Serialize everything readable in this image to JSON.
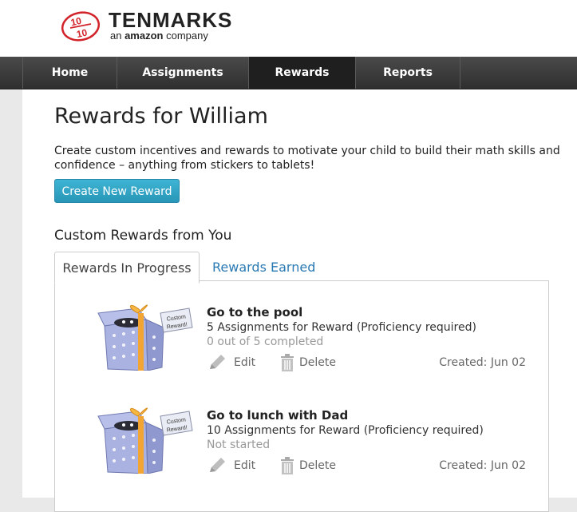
{
  "logo": {
    "brand": "TENMARKS",
    "tagline_prefix": "an ",
    "tagline_brand": "amazon",
    "tagline_suffix": " company",
    "mark_top": "10",
    "mark_bottom": "10"
  },
  "nav": {
    "items": [
      {
        "label": "Home",
        "active": false
      },
      {
        "label": "Assignments",
        "active": false
      },
      {
        "label": "Rewards",
        "active": true
      },
      {
        "label": "Reports",
        "active": false
      }
    ]
  },
  "page": {
    "title": "Rewards for William",
    "intro": "Create custom incentives and rewards to motivate your child to build their math skills and confidence – anything from stickers to tablets!",
    "create_button": "Create New Reward",
    "section_title": "Custom Rewards from You"
  },
  "tabs": [
    {
      "label": "Rewards In Progress",
      "active": true
    },
    {
      "label": "Rewards Earned",
      "active": false
    }
  ],
  "rewards": [
    {
      "title": "Go to the pool",
      "requirement": "5 Assignments for Reward (Proficiency required)",
      "status": "0 out of 5 completed",
      "edit_label": "Edit",
      "delete_label": "Delete",
      "created": "Created: Jun 02",
      "tag_line1": "Custom",
      "tag_line2": "Reward!"
    },
    {
      "title": "Go to lunch with Dad",
      "requirement": "10 Assignments for Reward (Proficiency required)",
      "status": "Not started",
      "edit_label": "Edit",
      "delete_label": "Delete",
      "created": "Created: Jun 02",
      "tag_line1": "Custom",
      "tag_line2": "Reward!"
    }
  ],
  "colors": {
    "accent": "#2a9bbd",
    "nav_bg": "#3b3b3b",
    "link": "#2a7ab3",
    "brand_red": "#d2232a"
  }
}
